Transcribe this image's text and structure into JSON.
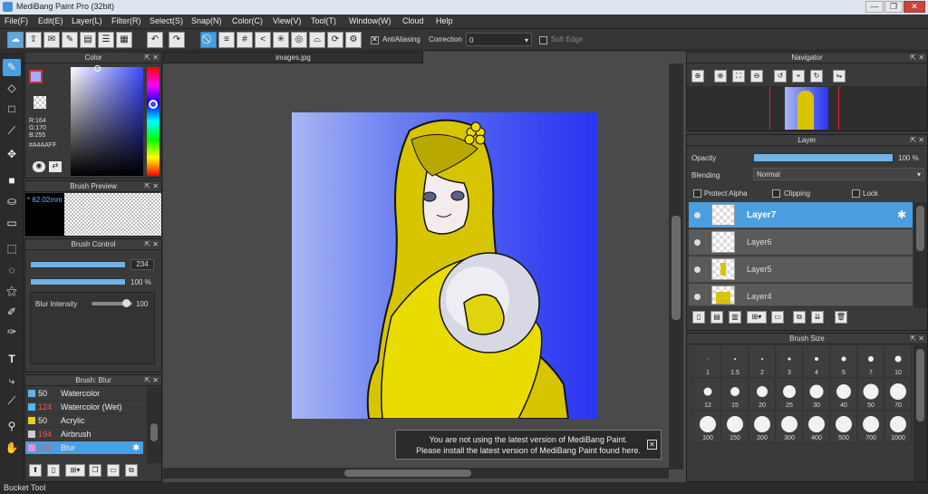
{
  "window": {
    "title": "MediBang Paint Pro (32bit)",
    "min": "—",
    "max": "❐",
    "close": "✕"
  },
  "menu": [
    "File(F)",
    "Edit(E)",
    "Layer(L)",
    "Filter(R)",
    "Select(S)",
    "Snap(N)",
    "Color(C)",
    "View(V)",
    "Tool(T)",
    "Window(W)",
    "Cloud",
    "Help"
  ],
  "toolbar": {
    "antialiasing_label": "AntiAliasing",
    "correction_label": "Correction",
    "correction_value": "0",
    "soft_edge_label": "Soft Edge"
  },
  "color_panel": {
    "title": "Color",
    "r": "R:164",
    "g": "G:170",
    "b": "B:255",
    "hex": "#A4AAFF",
    "fg": "#A4AAFF"
  },
  "brush_preview": {
    "title": "Brush Preview",
    "size": "* 62.02mm"
  },
  "brush_control": {
    "title": "Brush Control",
    "size_value": "234",
    "opacity_value": "100 %",
    "blur_label": "Blur Intensity",
    "blur_value": "100"
  },
  "brush_list": {
    "title": "Brush: Blur",
    "items": [
      {
        "size": "50",
        "name": "Watercolor",
        "color": "#5ab4ef",
        "size_color": "#eeeeee"
      },
      {
        "size": "124",
        "name": "Watercolor (Wet)",
        "color": "#5ab4ef",
        "size_color": "#e85b5b"
      },
      {
        "size": "50",
        "name": "Acrylic",
        "color": "#e6d21e",
        "size_color": "#eeeeee"
      },
      {
        "size": "194",
        "name": "Airbrush",
        "color": "#cccccc",
        "size_color": "#e85b5b"
      },
      {
        "size": "234",
        "name": "Blur",
        "color": "#e88ee0",
        "size_color": "#e85b5b"
      }
    ]
  },
  "canvas": {
    "tab": "images.jpg"
  },
  "notice": {
    "line1": "You are not using the latest version of MediBang Paint.",
    "line2": "Please install the latest version of MediBang Paint found here."
  },
  "navigator": {
    "title": "Navigator"
  },
  "layer_panel": {
    "title": "Layer",
    "opacity_label": "Opacity",
    "opacity_value": "100 %",
    "blending_label": "Blending",
    "blending_value": "Normal",
    "protect_alpha": "Protect Alpha",
    "clipping": "Clipping",
    "lock": "Lock",
    "layers": [
      "Layer7",
      "Layer6",
      "Layer5",
      "Layer4"
    ]
  },
  "brush_size": {
    "title": "Brush Size",
    "sizes": [
      "1",
      "1.5",
      "2",
      "3",
      "4",
      "5",
      "7",
      "10",
      "12",
      "15",
      "20",
      "25",
      "30",
      "40",
      "50",
      "70",
      "100",
      "150",
      "200",
      "300",
      "400",
      "500",
      "700",
      "1000"
    ]
  },
  "status": {
    "text": "Bucket Tool"
  }
}
